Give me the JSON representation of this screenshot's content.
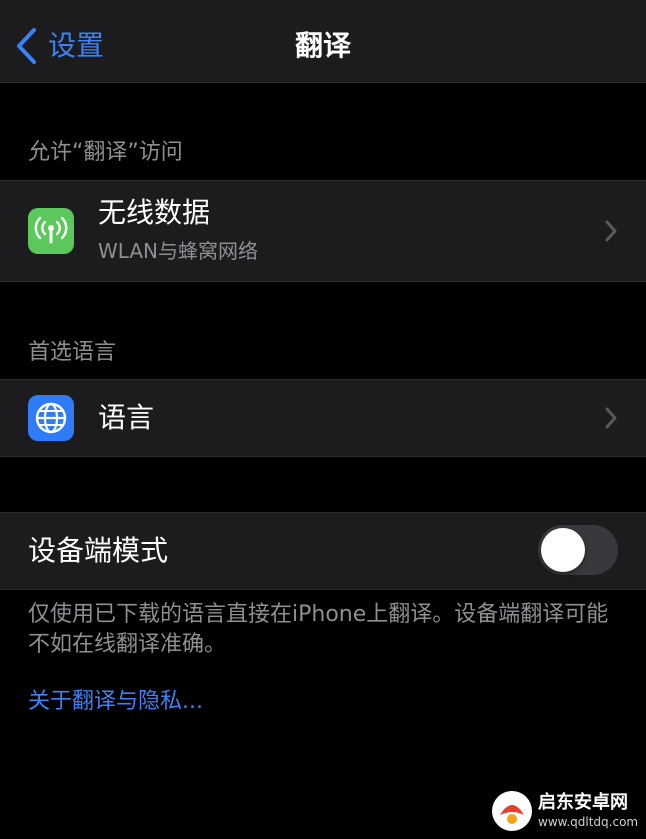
{
  "navbar": {
    "back_label": "设置",
    "title": "翻译"
  },
  "sections": {
    "access_header": "允许“翻译”访问",
    "language_header": "首选语言"
  },
  "rows": {
    "wireless": {
      "title": "无线数据",
      "subtitle": "WLAN与蜂窝网络",
      "icon": "antenna-icon",
      "icon_color": "#5ac85a"
    },
    "language": {
      "title": "语言",
      "icon": "globe-icon",
      "icon_color": "#2f7cf6"
    },
    "device_mode": {
      "title": "设备端模式",
      "toggle_on": false
    }
  },
  "footer": {
    "description": "仅使用已下载的语言直接在iPhone上翻译。设备端翻译可能不如在线翻译准确。",
    "privacy_link": "关于翻译与隐私..."
  },
  "watermark": {
    "name": "启东安卓网",
    "url": "www.qdltdq.com"
  },
  "colors": {
    "background": "#000000",
    "cell": "#1c1c1e",
    "accent": "#3a82f7",
    "secondary_text": "#8e8e93"
  }
}
